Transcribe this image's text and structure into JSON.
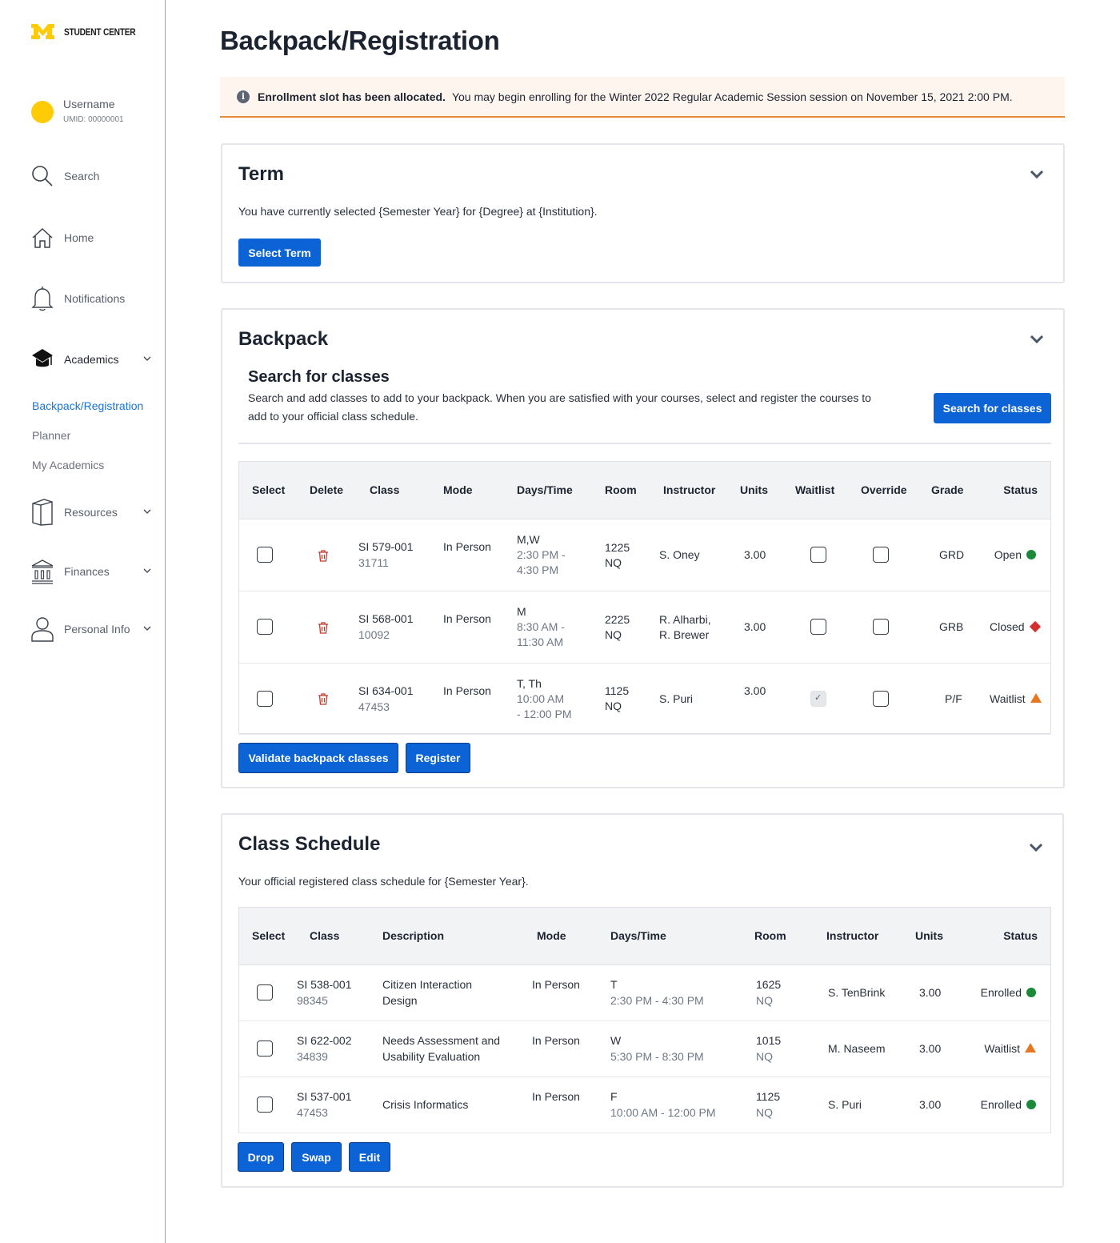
{
  "brand": {
    "logo": "M",
    "title": "STUDENT CENTER"
  },
  "user": {
    "name": "Username",
    "umid": "UMID: 00000001"
  },
  "nav": {
    "search": "Search",
    "home": "Home",
    "notifications": "Notifications",
    "academics": "Academics",
    "academics_sub": [
      "Backpack/Registration",
      "Planner",
      "My Academics"
    ],
    "resources": "Resources",
    "finances": "Finances",
    "personal_info": "Personal Info"
  },
  "page": {
    "title": "Backpack/Registration"
  },
  "alert": {
    "icon": "info-icon",
    "strong": "Enrollment slot has been allocated.",
    "text": "You may begin enrolling for the Winter 2022 Regular Academic Session session on November 15, 2021 2:00 PM."
  },
  "term": {
    "title": "Term",
    "text": "You have currently selected {Semester Year} for {Degree} at {Institution}.",
    "button": "Select Term"
  },
  "backpack": {
    "title": "Backpack",
    "search_title": "Search for classes",
    "search_text_1": "Search and add classes to add to your backpack. When you are satisfied with your courses,  select and register the courses to",
    "search_text_2": "add to your official class schedule.",
    "search_button": "Search for classes",
    "columns": [
      "Select",
      "Delete",
      "Class",
      "Mode",
      "Days/Time",
      "Room",
      "Instructor",
      "Units",
      "Waitlist",
      "Override",
      "Grade",
      "Status"
    ],
    "rows": [
      {
        "class": "SI 579-001",
        "class_num": "31711",
        "mode": "In Person",
        "days": "M,W",
        "time": "2:30 PM -",
        "time2": "4:30 PM",
        "room": "1225",
        "room2": "NQ",
        "instructor": "S. Oney",
        "instructor2": "",
        "units": "3.00",
        "waitlist": false,
        "override": false,
        "grade": "GRD",
        "status": "Open",
        "status_color": "#1a8a3a",
        "status_shape": "dot"
      },
      {
        "class": "SI 568-001",
        "class_num": "10092",
        "mode": "In Person",
        "days": "M",
        "time": "8:30 AM -",
        "time2": "11:30 AM",
        "room": "2225",
        "room2": "NQ",
        "instructor": "R. Alharbi,",
        "instructor2": "R. Brewer",
        "units": "3.00",
        "waitlist": false,
        "override": false,
        "grade": "GRB",
        "status": "Closed",
        "status_color": "#d62e2e",
        "status_shape": "diamond"
      },
      {
        "class": "SI 634-001",
        "class_num": "47453",
        "mode": "In Person",
        "days": "T, Th",
        "time": "10:00 AM",
        "time2": "- 12:00 PM",
        "room": "1125",
        "room2": "NQ",
        "instructor": "S. Puri",
        "instructor2": "",
        "units": "3.00",
        "waitlist": true,
        "override": false,
        "grade": "P/F",
        "status": "Waitlist",
        "status_color": "#e87722",
        "status_shape": "triangle"
      }
    ],
    "validate_button": "Validate backpack classes",
    "register_button": "Register"
  },
  "schedule": {
    "title": "Class Schedule",
    "text": "Your official registered class schedule for {Semester Year}.",
    "columns": [
      "Select",
      "Class",
      "Description",
      "Mode",
      "Days/Time",
      "Room",
      "Instructor",
      "Units",
      "Status"
    ],
    "rows": [
      {
        "class": "SI 538-001",
        "class_num": "98345",
        "desc": "Citizen Interaction",
        "desc2": "Design",
        "mode": "In Person",
        "days": "T",
        "time": "2:30 PM - 4:30 PM",
        "room": "1625",
        "room2": "NQ",
        "instructor": "S. TenBrink",
        "units": "3.00",
        "status": "Enrolled",
        "status_color": "#1a8a3a",
        "status_shape": "dot"
      },
      {
        "class": "SI 622-002",
        "class_num": "34839",
        "desc": "Needs Assessment and",
        "desc2": "Usability Evaluation",
        "mode": "In Person",
        "days": "W",
        "time": "5:30 PM - 8:30 PM",
        "room": "1015",
        "room2": "NQ",
        "instructor": "M. Naseem",
        "units": "3.00",
        "status": "Waitlist",
        "status_color": "#e87722",
        "status_shape": "triangle"
      },
      {
        "class": "SI 537-001",
        "class_num": "47453",
        "desc": "Crisis Informatics",
        "desc2": "",
        "mode": "In Person",
        "days": "F",
        "time": "10:00 AM - 12:00 PM",
        "room": "1125",
        "room2": "NQ",
        "instructor": "S. Puri",
        "units": "3.00",
        "status": "Enrolled",
        "status_color": "#1a8a3a",
        "status_shape": "dot"
      }
    ],
    "buttons": {
      "drop": "Drop",
      "swap": "Swap",
      "edit": "Edit"
    }
  },
  "colors": {
    "maize": "#ffcb05",
    "primary": "#0b63d6",
    "link": "#1a73d6",
    "alert_border": "#e88a3a",
    "trash": "#c0392b"
  }
}
